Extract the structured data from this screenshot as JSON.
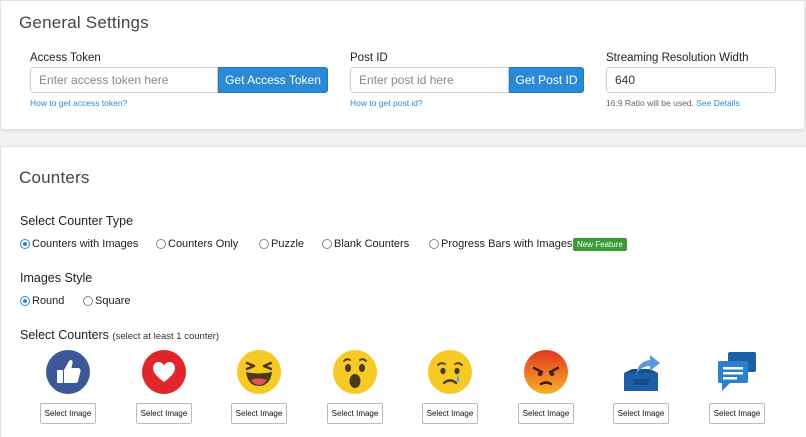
{
  "general": {
    "title": "General Settings",
    "access_token": {
      "label": "Access Token",
      "placeholder": "Enter access token here",
      "button": "Get Access Token",
      "help": "How to get access token?"
    },
    "post_id": {
      "label": "Post ID",
      "placeholder": "Enter post id here",
      "button": "Get Post ID",
      "help": "How to get post id?"
    },
    "resolution": {
      "label": "Streaming Resolution Width",
      "value": "640",
      "note": "16:9 Ratio will be used.",
      "link": "See Details"
    }
  },
  "counters": {
    "title": "Counters",
    "counter_type": {
      "title": "Select Counter Type",
      "options": [
        "Counters with Images",
        "Counters Only",
        "Puzzle",
        "Blank Counters",
        "Progress Bars with Images"
      ],
      "selected": "Counters with Images",
      "badge": "New Feature"
    },
    "images_style": {
      "title": "Images Style",
      "options": [
        "Round",
        "Square"
      ],
      "selected": "Round"
    },
    "select_counters": {
      "title": "Select Counters",
      "subtitle": "(select at least 1 counter)",
      "items": [
        {
          "icon": "like-icon",
          "button": "Select Image"
        },
        {
          "icon": "love-icon",
          "button": "Select Image"
        },
        {
          "icon": "haha-icon",
          "button": "Select Image"
        },
        {
          "icon": "wow-icon",
          "button": "Select Image"
        },
        {
          "icon": "sad-icon",
          "button": "Select Image"
        },
        {
          "icon": "angry-icon",
          "button": "Select Image"
        },
        {
          "icon": "share-icon",
          "button": "Select Image"
        },
        {
          "icon": "comment-icon",
          "button": "Select Image"
        }
      ]
    }
  },
  "colors": {
    "accent": "#2a8ad8",
    "badge": "#3c9a36",
    "like_blue": "#3b5998",
    "love_red": "#e0252b",
    "emoji_yellow": "#f7c924",
    "angry_orange": "#e85a23"
  }
}
